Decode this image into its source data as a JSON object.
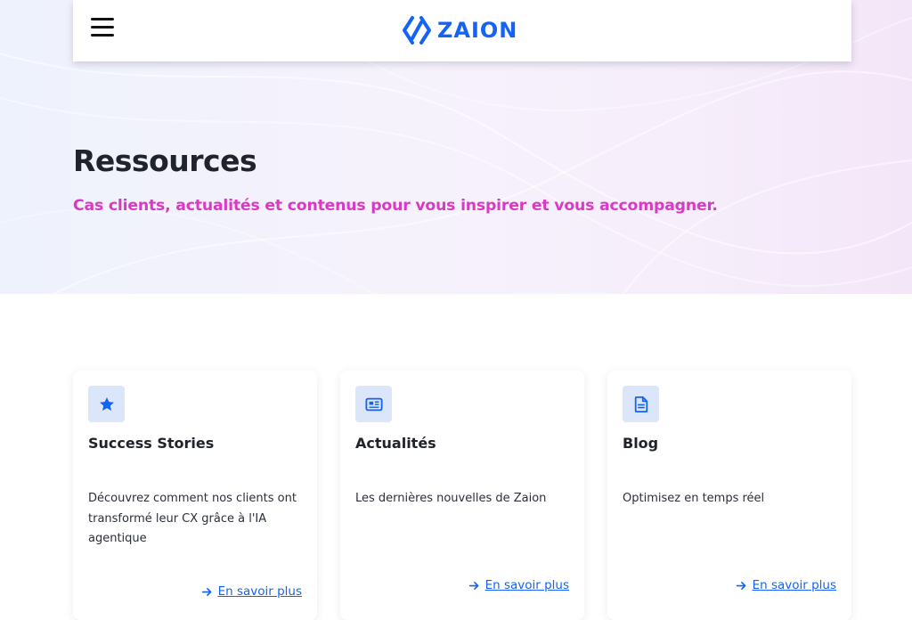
{
  "header": {
    "menu_icon": "hamburger-menu-icon",
    "logo_text": "ZAION",
    "logo_icon": "zaion-mark-icon"
  },
  "hero": {
    "title": "Ressources",
    "subtitle": "Cas clients, actualités et contenus pour vous inspirer et vous accompagner."
  },
  "cards": [
    {
      "icon": "star-icon",
      "title": "Success Stories",
      "description": "Découvrez comment nos clients ont transformé leur CX grâce à l'IA agentique",
      "link_label": "En savoir plus",
      "link_icon": "arrow-right-icon"
    },
    {
      "icon": "newspaper-icon",
      "title": "Actualités",
      "description": "Les dernières nouvelles de Zaion",
      "link_label": "En savoir plus",
      "link_icon": "arrow-right-icon"
    },
    {
      "icon": "document-icon",
      "title": "Blog",
      "description": "Optimisez en temps réel",
      "link_label": "En savoir plus",
      "link_icon": "arrow-right-icon"
    }
  ],
  "colors": {
    "brand_blue": "#1463f3",
    "accent_magenta": "#d83ac4",
    "icon_tile": "#dbe6fb",
    "heading": "#20222c"
  }
}
